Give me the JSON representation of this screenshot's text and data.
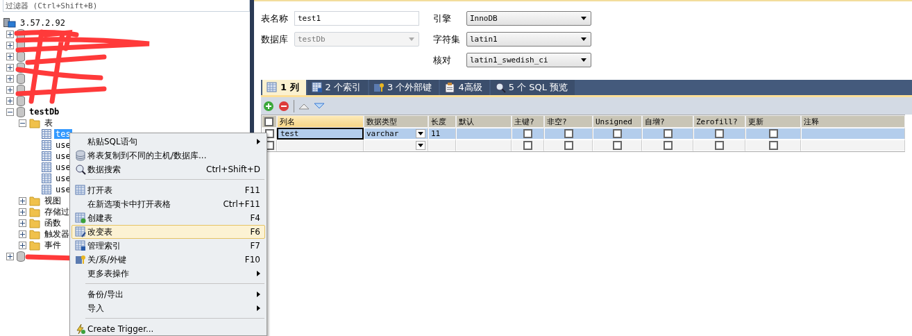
{
  "filter": {
    "placeholder": "过滤器 (Ctrl+Shift+B)"
  },
  "tree": {
    "label": "3.57.2.92",
    "children": [
      {
        "kind": "hidden",
        "expanded": false
      },
      {
        "kind": "hidden",
        "expanded": false
      },
      {
        "kind": "hidden",
        "expanded": false
      },
      {
        "kind": "hidden",
        "expanded": false
      },
      {
        "kind": "hidden",
        "expanded": false
      },
      {
        "kind": "hidden",
        "expanded": false
      },
      {
        "kind": "hidden",
        "expanded": false
      },
      {
        "kind": "database",
        "label": "testDb",
        "expanded": true,
        "children": [
          {
            "kind": "folder",
            "label": "表",
            "expanded": true,
            "children": [
              {
                "kind": "table",
                "label": "tes",
                "selected": true
              },
              {
                "kind": "table",
                "label": "use",
                "selected": false
              },
              {
                "kind": "table",
                "label": "use",
                "selected": false
              },
              {
                "kind": "table",
                "label": "use",
                "selected": false
              },
              {
                "kind": "table",
                "label": "use",
                "selected": false
              },
              {
                "kind": "table",
                "label": "use",
                "selected": false
              }
            ]
          },
          {
            "kind": "folder",
            "label": "视图",
            "expanded": false
          },
          {
            "kind": "folder",
            "label": "存储过",
            "expanded": false
          },
          {
            "kind": "folder",
            "label": "函数",
            "expanded": false
          },
          {
            "kind": "folder",
            "label": "触发器",
            "expanded": false
          },
          {
            "kind": "folder",
            "label": "事件",
            "expanded": false
          }
        ]
      },
      {
        "kind": "hidden-database",
        "expanded": false
      }
    ]
  },
  "form": {
    "table_name": {
      "label": "表名称",
      "value": "test1"
    },
    "database": {
      "label": "数据库",
      "value": "testDb",
      "disabled": true
    },
    "engine": {
      "label": "引擎",
      "value": "InnoDB"
    },
    "charset": {
      "label": "字符集",
      "value": "latin1"
    },
    "collation": {
      "label": "核对",
      "value": "latin1_swedish_ci"
    }
  },
  "tabs": [
    {
      "label": "1 列",
      "selected": true
    },
    {
      "label": "2 个索引",
      "selected": false
    },
    {
      "label": "3 个外部键",
      "selected": false
    },
    {
      "label": "4高级",
      "selected": false
    },
    {
      "label": "5 个 SQL 预览",
      "selected": false
    }
  ],
  "all_checked": false,
  "columns": [
    "列名",
    "数据类型",
    "长度",
    "默认",
    "主键?",
    "非空?",
    "Unsigned",
    "自增?",
    "Zerofill?",
    "更新",
    "注释"
  ],
  "rows": [
    {
      "selected": true,
      "name": "test",
      "type": "varchar",
      "length": "11",
      "checks": [
        false,
        false,
        false,
        false,
        false,
        false
      ],
      "checked": false
    },
    {
      "selected": false,
      "name": "",
      "type": "",
      "length": "",
      "checks": [
        false,
        false,
        false,
        false,
        false,
        false
      ],
      "checked": false
    }
  ],
  "context_menu": [
    {
      "kind": "item",
      "label": "粘贴SQL语句",
      "submenu": true,
      "selected": false
    },
    {
      "kind": "item",
      "label": "将表复制到不同的主机/数据库...",
      "selected": false
    },
    {
      "kind": "item",
      "label": "数据搜索",
      "shortcut": "Ctrl+Shift+D",
      "selected": false
    },
    {
      "kind": "separator"
    },
    {
      "kind": "item",
      "label": "打开表",
      "shortcut": "F11",
      "selected": false
    },
    {
      "kind": "item",
      "label": "在新选项卡中打开表格",
      "shortcut": "Ctrl+F11",
      "selected": false
    },
    {
      "kind": "item",
      "label": "创建表",
      "shortcut": "F4",
      "selected": false
    },
    {
      "kind": "item",
      "label": "改变表",
      "shortcut": "F6",
      "selected": true
    },
    {
      "kind": "item",
      "label": "管理索引",
      "shortcut": "F7",
      "selected": false
    },
    {
      "kind": "item",
      "label": "关/系/外键",
      "shortcut": "F10",
      "selected": false
    },
    {
      "kind": "item",
      "label": "更多表操作",
      "submenu": true,
      "selected": false
    },
    {
      "kind": "separator"
    },
    {
      "kind": "item",
      "label": "备份/导出",
      "submenu": true,
      "selected": false
    },
    {
      "kind": "item",
      "label": "导入",
      "submenu": true,
      "selected": false
    },
    {
      "kind": "separator"
    },
    {
      "kind": "item",
      "label": "Create Trigger...",
      "selected": false
    }
  ]
}
